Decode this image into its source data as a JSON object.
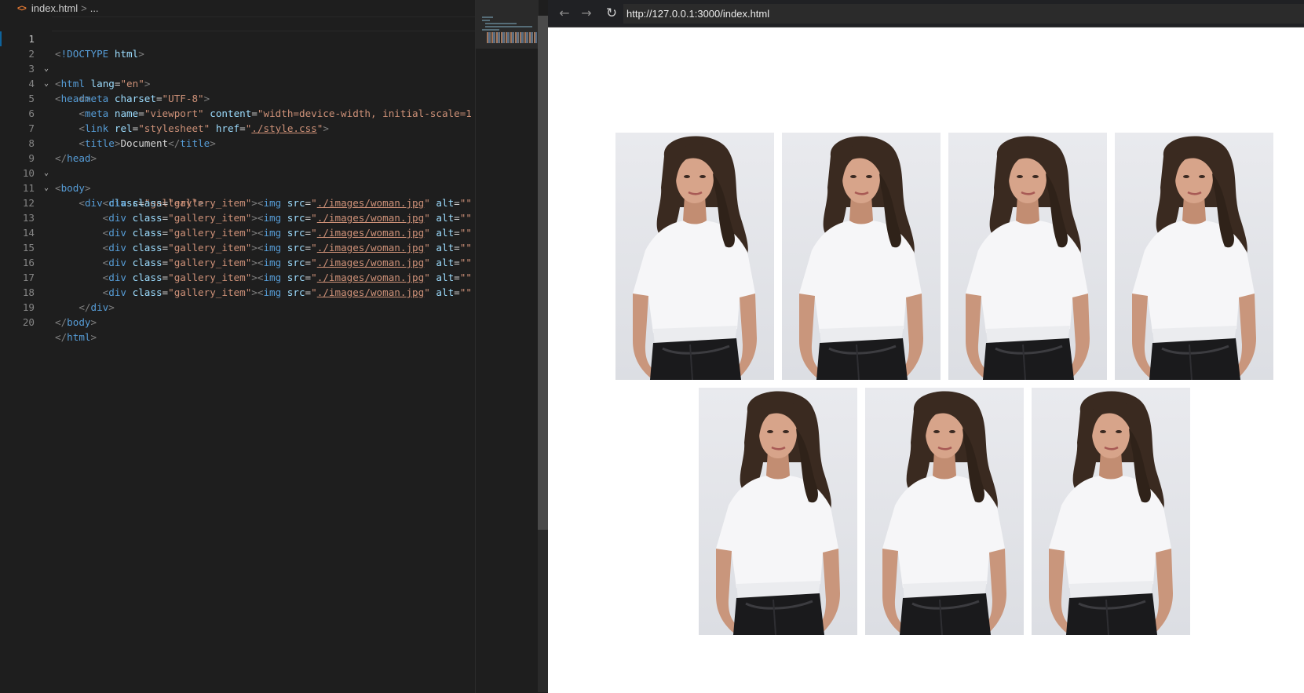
{
  "editor": {
    "breadcrumb": {
      "file": "index.html",
      "separator": ">",
      "more": "..."
    },
    "lines": [
      {
        "n": "1"
      },
      {
        "n": "2"
      },
      {
        "n": "3"
      },
      {
        "n": "4"
      },
      {
        "n": "5"
      },
      {
        "n": "6"
      },
      {
        "n": "7"
      },
      {
        "n": "8"
      },
      {
        "n": "9"
      },
      {
        "n": "10"
      },
      {
        "n": "11"
      },
      {
        "n": "12"
      },
      {
        "n": "13"
      },
      {
        "n": "14"
      },
      {
        "n": "15"
      },
      {
        "n": "16"
      },
      {
        "n": "17"
      },
      {
        "n": "18"
      },
      {
        "n": "19"
      },
      {
        "n": "20"
      }
    ],
    "code": {
      "doctype": "!DOCTYPE",
      "html": "html",
      "lang_attr": "lang",
      "lang_val": "\"en\"",
      "head": "head",
      "meta": "meta",
      "charset_attr": "charset",
      "charset_val": "\"UTF-8\"",
      "name_attr": "name",
      "name_val": "\"viewport\"",
      "content_attr": "content",
      "content_val": "\"width=device-width, initial-scale=1",
      "link": "link",
      "rel_attr": "rel",
      "rel_val": "\"stylesheet\"",
      "href_attr": "href",
      "href_q": "\"",
      "href_val": "./style.css",
      "title": "title",
      "title_text": "Document",
      "body": "body",
      "div": "div",
      "class_attr": "class",
      "gallery_val": "\"gallery\"",
      "item_val": "\"gallery_item\"",
      "img": "img",
      "src_attr": "src",
      "src_val": "./images/woman.jpg",
      "alt_attr": "alt",
      "alt_val": "\"\""
    }
  },
  "browser": {
    "back": "←",
    "forward": "→",
    "reload": "↻",
    "url": "http://127.0.0.1:3000/index.html",
    "gallery_count": 7
  },
  "colors": {
    "editor_bg": "#1e1e1e",
    "browser_toolbar": "#202124",
    "page_bg": "#ffffff",
    "photo_bg": "#e5e6ea"
  }
}
